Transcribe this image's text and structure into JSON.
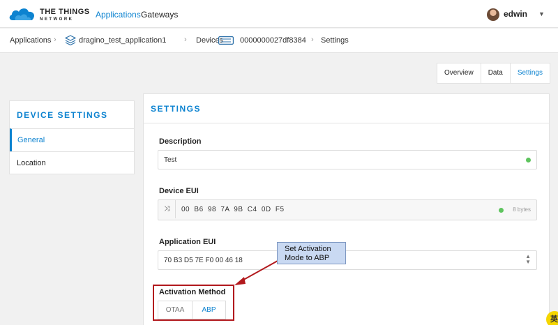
{
  "header": {
    "brand_name": "THE THINGS",
    "brand_sub": "NETWORK",
    "nav": [
      "Applications",
      "Gateways"
    ],
    "user": "edwin"
  },
  "breadcrumb": {
    "items": [
      "Applications",
      "dragino_test_application1",
      "Devices",
      "0000000027df8384",
      "Settings"
    ]
  },
  "tabs": [
    "Overview",
    "Data",
    "Settings"
  ],
  "sidebar": {
    "title": "DEVICE SETTINGS",
    "items": [
      "General",
      "Location"
    ]
  },
  "main": {
    "title": "SETTINGS",
    "description": {
      "label": "Description",
      "value": "Test"
    },
    "device_eui": {
      "label": "Device EUI",
      "value": "00 B6 98 7A 9B C4 0D F5",
      "bytes": "8 bytes"
    },
    "application_eui": {
      "label": "Application EUI",
      "value": "70 B3 D5 7E F0 00 46 18"
    },
    "activation": {
      "label": "Activation Method",
      "options": [
        "OTAA",
        "ABP"
      ],
      "selected": "ABP"
    }
  },
  "annotation": {
    "callout_line1": "Set Activation",
    "callout_line2": "Mode to ABP",
    "color": "#b2191d"
  },
  "corner_badge": "英",
  "colors": {
    "accent": "#0d83d0",
    "ok": "#5ec45e"
  }
}
